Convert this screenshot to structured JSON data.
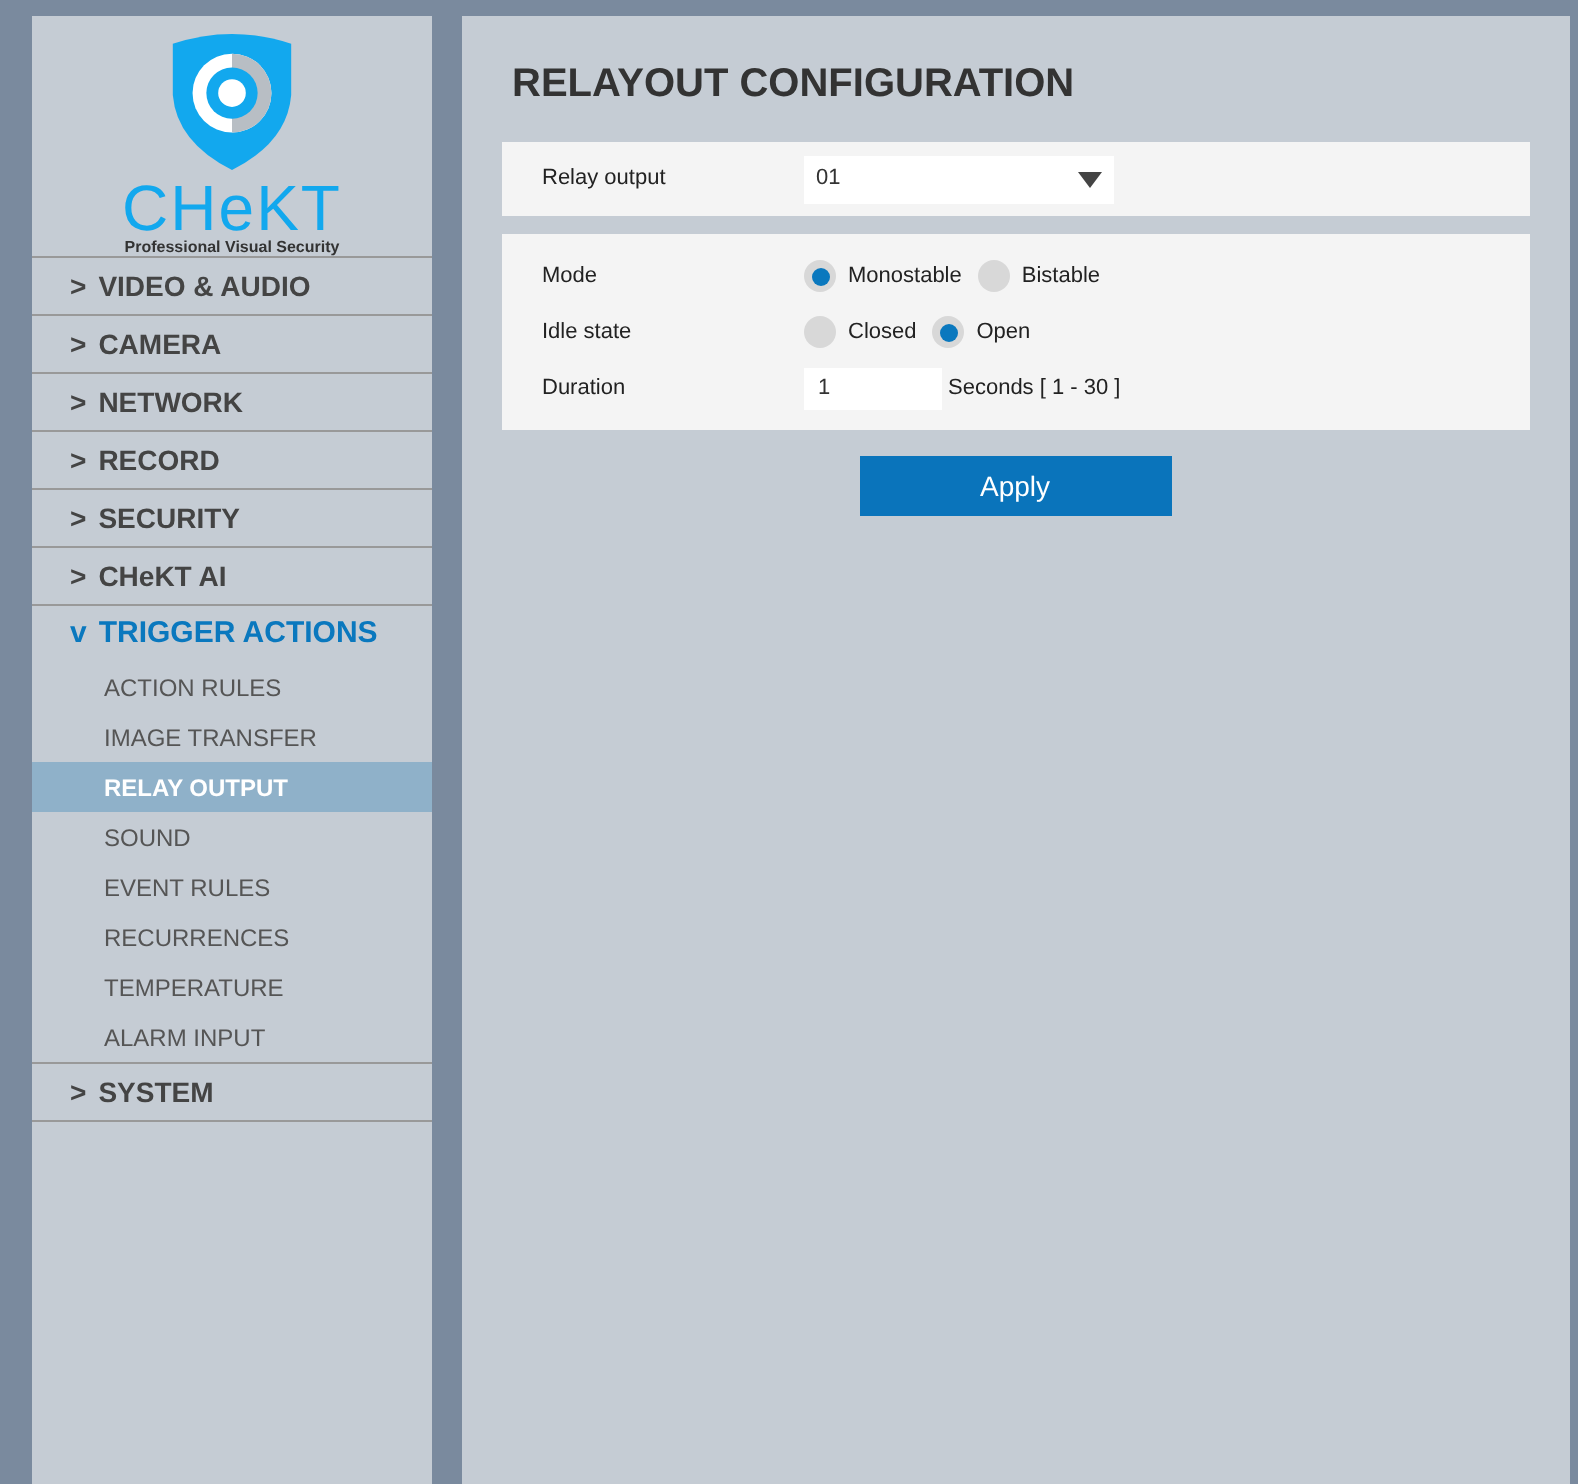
{
  "logo": {
    "brand": "CHeKT",
    "tagline": "Professional Visual Security"
  },
  "menu": [
    {
      "marker": ">",
      "label": "VIDEO & AUDIO",
      "expanded": false
    },
    {
      "marker": ">",
      "label": "CAMERA",
      "expanded": false
    },
    {
      "marker": ">",
      "label": "NETWORK",
      "expanded": false
    },
    {
      "marker": ">",
      "label": "RECORD",
      "expanded": false
    },
    {
      "marker": ">",
      "label": "SECURITY",
      "expanded": false
    },
    {
      "marker": ">",
      "label": "CHeKT AI",
      "expanded": false
    },
    {
      "marker": "v",
      "label": "TRIGGER ACTIONS",
      "expanded": true,
      "children": [
        {
          "label": "ACTION RULES",
          "selected": false
        },
        {
          "label": "IMAGE TRANSFER",
          "selected": false
        },
        {
          "label": "RELAY OUTPUT",
          "selected": true
        },
        {
          "label": "SOUND",
          "selected": false
        },
        {
          "label": "EVENT RULES",
          "selected": false
        },
        {
          "label": "RECURRENCES",
          "selected": false
        },
        {
          "label": "TEMPERATURE",
          "selected": false
        },
        {
          "label": "ALARM INPUT",
          "selected": false
        }
      ]
    },
    {
      "marker": ">",
      "label": "SYSTEM",
      "expanded": false
    }
  ],
  "page": {
    "title": "RELAYOUT CONFIGURATION",
    "relay_output": {
      "label": "Relay output",
      "value": "01"
    },
    "settings": [
      {
        "kind": "radio",
        "label": "Mode",
        "options": [
          {
            "label": "Monostable",
            "selected": true
          },
          {
            "label": "Bistable",
            "selected": false
          }
        ]
      },
      {
        "kind": "radio",
        "label": "Idle state",
        "options": [
          {
            "label": "Closed",
            "selected": false
          },
          {
            "label": "Open",
            "selected": true
          }
        ]
      },
      {
        "kind": "input",
        "label": "Duration",
        "value": "1",
        "suffix": "Seconds [ 1 - 30 ]"
      }
    ],
    "apply": "Apply"
  }
}
